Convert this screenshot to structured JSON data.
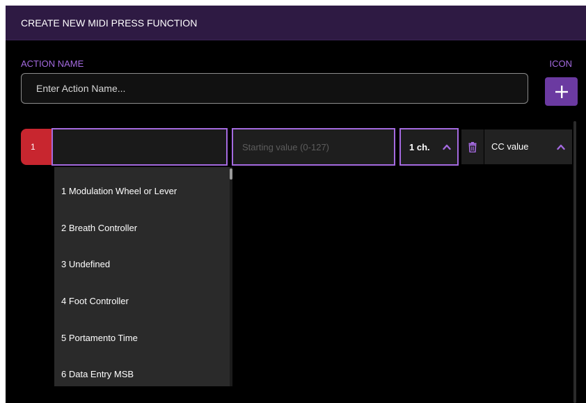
{
  "dialog": {
    "title": "CREATE NEW MIDI PRESS FUNCTION"
  },
  "form": {
    "action_name_label": "ACTION NAME",
    "icon_label": "ICON",
    "action_name_placeholder": "Enter Action Name...",
    "action_name_value": "",
    "add_icon": "plus-icon"
  },
  "row": {
    "number": "1",
    "cc_select_value": "",
    "starting_value_placeholder": "Starting value (0-127)",
    "channel_label": "1 ch.",
    "type_label": "CC value",
    "delete_icon": "trash-icon",
    "chevron_icon": "chevron-up-icon"
  },
  "dropdown": {
    "items": [
      "1 Modulation Wheel or Lever",
      "2 Breath Controller",
      "3 Undefined",
      "4 Foot Controller",
      "5 Portamento Time",
      "6 Data Entry MSB"
    ]
  },
  "colors": {
    "accent": "#a46ae0",
    "titlebar": "#2e1a43",
    "row_number_bg": "#c8262f",
    "icon_button_bg": "#6b3aa1"
  }
}
